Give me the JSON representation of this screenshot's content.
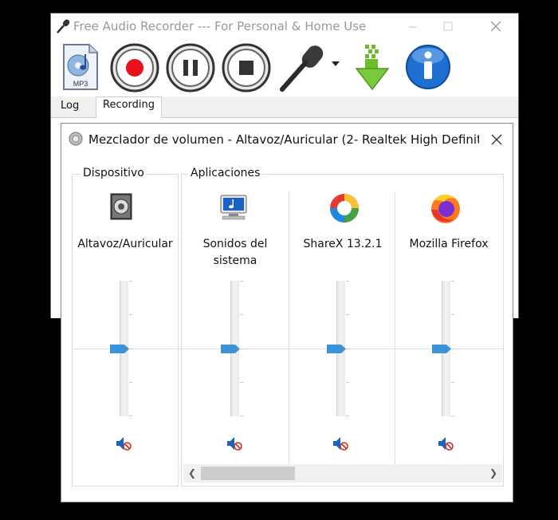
{
  "recorder": {
    "title": "Free Audio Recorder  ---  For Personal & Home Use",
    "toolbar_icons": [
      "mp3-file-icon",
      "record-icon",
      "pause-icon",
      "stop-icon",
      "microphone-icon",
      "dropdown-arrow-icon",
      "download-arrow-icon",
      "info-icon"
    ],
    "tabs": [
      {
        "label": "Log",
        "active": false
      },
      {
        "label": "Recording",
        "active": true
      }
    ]
  },
  "mixer": {
    "title": "Mezclador de volumen - Altavoz/Auricular (2- Realtek High Definiti...",
    "device_group_label": "Dispositivo",
    "apps_group_label": "Aplicaciones",
    "device": {
      "name": "Altavoz/Auricular",
      "volume_percent": 50,
      "muted": true
    },
    "apps": [
      {
        "name": "Sonidos del sistema",
        "volume_percent": 50,
        "muted": true
      },
      {
        "name": "ShareX 13.2.1",
        "volume_percent": 50,
        "muted": true
      },
      {
        "name": "Mozilla Firefox",
        "volume_percent": 50,
        "muted": true
      }
    ]
  },
  "colors": {
    "record_red": "#e8121b",
    "thumb_blue": "#3c93d8",
    "info_blue": "#1e6fd1",
    "download_green": "#6bbd2a"
  }
}
